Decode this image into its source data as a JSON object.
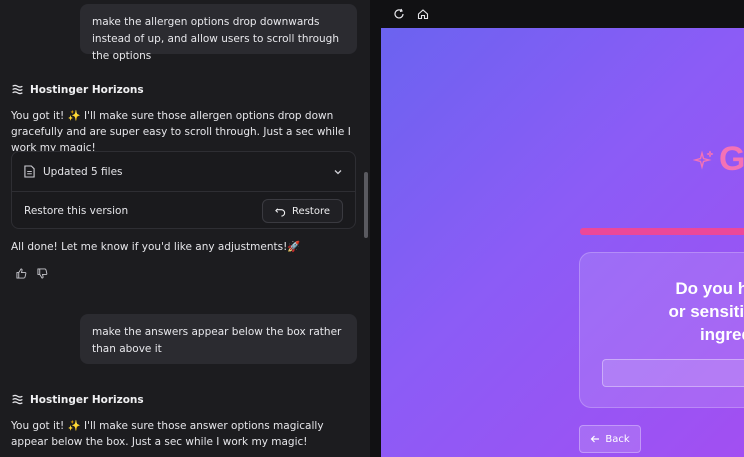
{
  "chat": {
    "messages": [
      {
        "role": "user",
        "text": "make the allergen options drop downwards instead of up, and allow users to scroll through the options"
      },
      {
        "role": "assistant",
        "brand": "Hostinger Horizons",
        "text": "You got it! ✨ I'll make sure those allergen options drop down gracefully and are super easy to scroll through. Just a sec while I work my magic!",
        "files_label": "Updated 5 files",
        "restore_label": "Restore this version",
        "restore_button": "Restore",
        "done_text": "All done! Let me know if you'd like any adjustments!🚀"
      },
      {
        "role": "user",
        "text": "make the answers appear below the box rather than above it"
      },
      {
        "role": "assistant",
        "brand": "Hostinger Horizons",
        "text": "You got it! ✨ I'll make sure those answer options magically appear below the box. Just a sec while I work my magic!"
      }
    ]
  },
  "preview": {
    "toolbar": {
      "refresh_icon": "refresh-icon",
      "home_icon": "home-icon"
    },
    "logo_partial": "G",
    "question": "Do you have any k\nor sensitivities\ningredie",
    "back_label": "Back"
  },
  "colors": {
    "accent_pink": "#ec4899",
    "bg_purple": "#8b5cf6",
    "panel_dark": "#1c1c1f"
  }
}
